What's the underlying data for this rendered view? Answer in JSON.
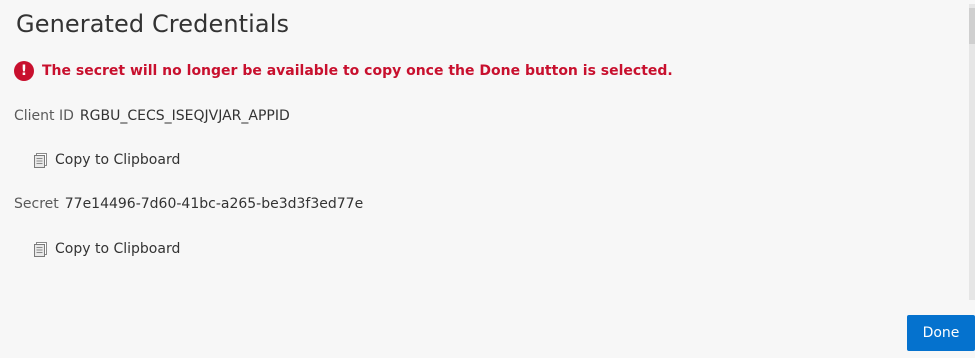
{
  "dialog": {
    "title": "Generated Credentials",
    "warning": {
      "icon": "error-icon",
      "icon_glyph": "!",
      "text": "The secret will no longer be available to copy once the Done button is selected.",
      "color": "#c8102e"
    },
    "client_id": {
      "label": "Client ID",
      "value": "RGBU_CECS_ISEQJVJAR_APPID",
      "copy_label": "Copy to Clipboard",
      "copy_icon": "clipboard-icon"
    },
    "secret": {
      "label": "Secret",
      "value": "77e14496-7d60-41bc-a265-be3d3f3ed77e",
      "copy_label": "Copy to Clipboard",
      "copy_icon": "clipboard-icon"
    },
    "done_label": "Done",
    "accent_color": "#0572ce"
  }
}
